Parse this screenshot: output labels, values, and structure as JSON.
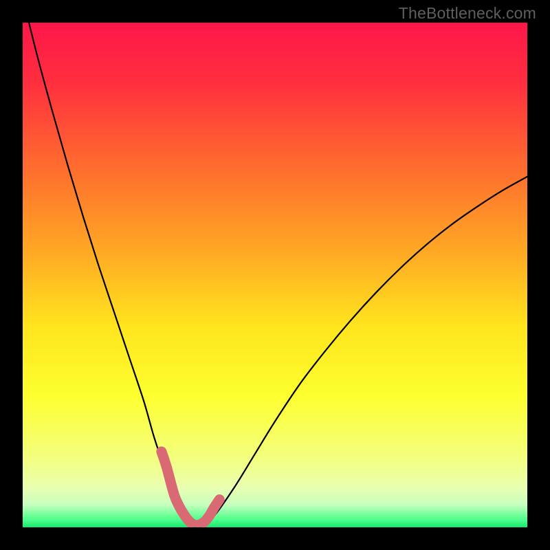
{
  "watermark": "TheBottleneck.com",
  "chart_data": {
    "type": "line",
    "title": "",
    "xlabel": "",
    "ylabel": "",
    "xlim": [
      0,
      100
    ],
    "ylim": [
      0,
      100
    ],
    "series": [
      {
        "name": "bottleneck-curve",
        "x": [
          0,
          3,
          6,
          9,
          12,
          15,
          18,
          21,
          24,
          26,
          28,
          30,
          32,
          34,
          36,
          38,
          42,
          46,
          50,
          55,
          60,
          65,
          70,
          75,
          80,
          85,
          90,
          95,
          100
        ],
        "values": [
          105,
          93,
          82,
          71.5,
          61.5,
          52,
          43,
          34,
          25,
          18,
          12,
          6.5,
          2.5,
          0.5,
          0.5,
          2.3,
          8,
          14.5,
          21,
          28.5,
          35,
          41,
          46.5,
          51.5,
          56,
          60,
          63.5,
          66.7,
          69.5
        ]
      },
      {
        "name": "highlight-band",
        "x": [
          27.5,
          28.5,
          30,
          31,
          32,
          33,
          34,
          35,
          36,
          37,
          38,
          39
        ],
        "values": [
          15,
          12,
          6.5,
          4.2,
          2.5,
          1.2,
          0.5,
          0.5,
          1.1,
          2.3,
          4,
          5.5
        ]
      }
    ],
    "gradient_stops": [
      {
        "offset": 0.0,
        "color": "#ff1649"
      },
      {
        "offset": 0.12,
        "color": "#ff2f3f"
      },
      {
        "offset": 0.28,
        "color": "#ff6a2f"
      },
      {
        "offset": 0.45,
        "color": "#ffa724"
      },
      {
        "offset": 0.6,
        "color": "#ffe41e"
      },
      {
        "offset": 0.74,
        "color": "#fdff2f"
      },
      {
        "offset": 0.86,
        "color": "#f4ff7d"
      },
      {
        "offset": 0.92,
        "color": "#eaffb0"
      },
      {
        "offset": 0.955,
        "color": "#c7ffbf"
      },
      {
        "offset": 0.985,
        "color": "#4dff8a"
      },
      {
        "offset": 1.0,
        "color": "#17e86f"
      }
    ],
    "highlight_color": "#d96a74",
    "curve_color": "#000000"
  }
}
